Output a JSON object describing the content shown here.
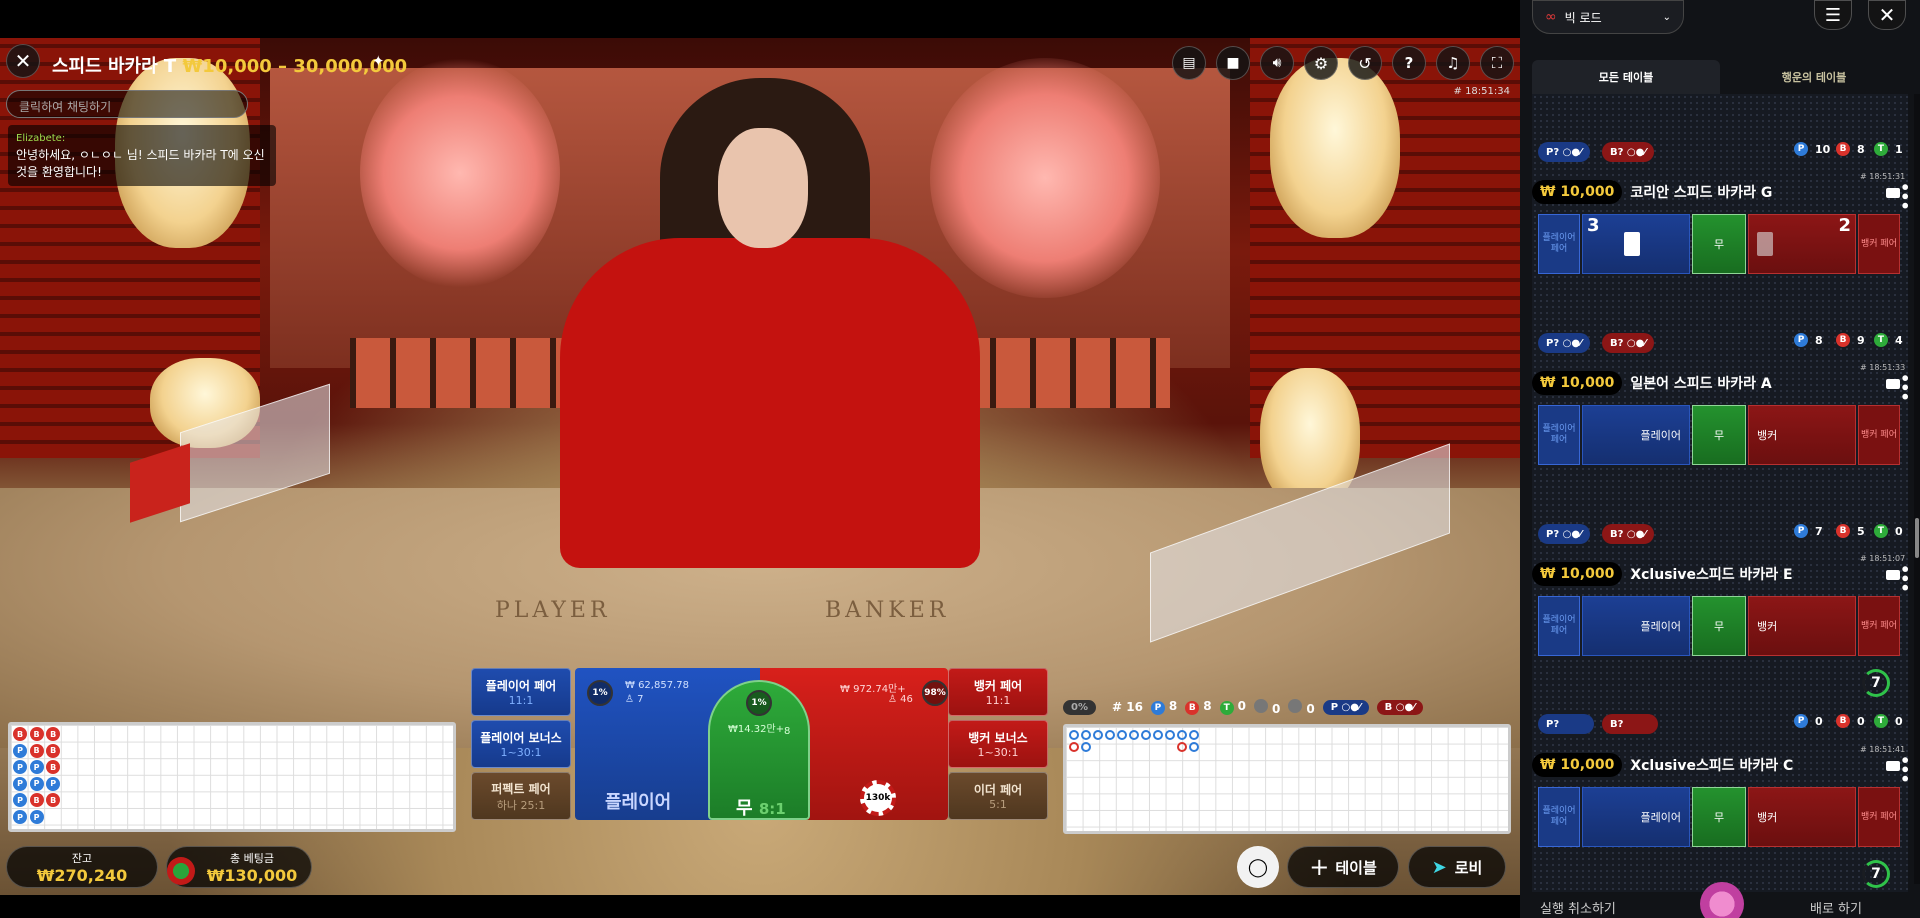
{
  "game": {
    "title": "스피드 바카라 T",
    "limit": "₩10,000 – 30,000,000",
    "clock": "# 18:51:34",
    "chat_placeholder": "클릭하여 채팅하기",
    "chat": {
      "author": "Elizabete:",
      "message": "안녕하세요, ㅇㄴㅇㄴ 님! 스피드 바카라 T에 오신 것을 환영합니다!"
    },
    "felt_player": "PLAYER",
    "felt_banker": "BANKER"
  },
  "bets": {
    "player_pair": {
      "label": "플레이어 페어",
      "odds": "11:1"
    },
    "player_bonus": {
      "label": "플레이어 보너스",
      "odds": "1~30:1"
    },
    "perfect_pair": {
      "label": "퍼펙트 페어",
      "odds": "하나 25:1"
    },
    "banker_pair": {
      "label": "뱅커 페어",
      "odds": "11:1"
    },
    "banker_bonus": {
      "label": "뱅커 보너스",
      "odds": "1~30:1"
    },
    "either_pair": {
      "label": "이더 페어",
      "odds": "5:1"
    },
    "player": {
      "label": "플레이어",
      "amount": "₩ 62,857.78",
      "players": "7",
      "pct": "1%"
    },
    "tie": {
      "label": "무",
      "odds": "8:1",
      "amount": "₩14.32만+",
      "players": "8",
      "pct": "1%"
    },
    "banker": {
      "amount": "₩ 972.74만+",
      "players": "46",
      "pct": "98%",
      "chip": "130k"
    }
  },
  "stats": {
    "zero_pct": "0%",
    "rounds": "# 16",
    "p": "8",
    "b": "8",
    "t": "0",
    "pp": "0",
    "bp": "0",
    "p_pred": "P",
    "b_pred": "B"
  },
  "bead_road": [
    [
      "B",
      "B",
      "B"
    ],
    [
      "P",
      "B",
      "B"
    ],
    [
      "P",
      "P",
      "B"
    ],
    [
      "P",
      "P",
      "P"
    ],
    [
      "P",
      "B",
      "B"
    ],
    [
      "P",
      "P",
      ""
    ]
  ],
  "bottom": {
    "balance_label": "잔고",
    "balance": "₩270,240",
    "total_bet_label": "총 베팅금",
    "total_bet": "₩130,000",
    "tables_label": "테이블",
    "lobby_label": "로비"
  },
  "sidebar": {
    "view_select": "빅 로드",
    "tabs": [
      "모든 테이블",
      "행운의 테이블"
    ],
    "tables": [
      {
        "name": "코리안 스피드 바카라 G",
        "limit": "₩ 10,000",
        "time": "# 18:51:31",
        "player_score": "3",
        "banker_score": "2",
        "p": "10",
        "b": "8",
        "t": "1",
        "prev_p": "8",
        "prev_b": "9",
        "prev_t": "4"
      },
      {
        "name": "일본어 스피드 바카라 A",
        "limit": "₩ 10,000",
        "time": "# 18:51:33",
        "p": "7",
        "b": "5",
        "t": "0"
      },
      {
        "name": "Xclusive스피드 바카라 E",
        "limit": "₩ 10,000",
        "time": "# 18:51:07",
        "timer": "7",
        "p": "0",
        "b": "0",
        "t": "0"
      },
      {
        "name": "Xclusive스피드 바카라 C",
        "limit": "₩ 10,000",
        "time": "# 18:51:41",
        "timer": "7"
      }
    ],
    "labels": {
      "player_pair": "플레이어 페어",
      "banker_pair": "뱅커 페어",
      "player": "플레이어",
      "tie": "무",
      "banker": "뱅커",
      "p_pred": "P?",
      "b_pred": "B?"
    },
    "footer_left": "실행 취소하기",
    "footer_right": "배로 하기"
  },
  "colors": {
    "accent_gold": "#f3c93c",
    "player_blue": "#2053c2",
    "banker_red": "#d8201b",
    "tie_green": "#2eab3a"
  }
}
